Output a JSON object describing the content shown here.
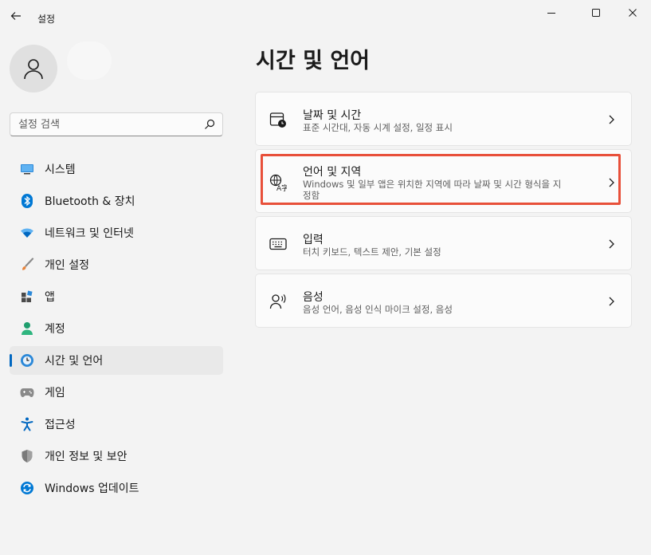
{
  "window": {
    "title": "설정"
  },
  "sidebar": {
    "search_placeholder": "설정 검색",
    "items": [
      {
        "label": "시스템",
        "icon": "monitor-icon",
        "active": false
      },
      {
        "label": "Bluetooth & 장치",
        "icon": "bluetooth-icon",
        "active": false
      },
      {
        "label": "네트워크 및 인터넷",
        "icon": "wifi-icon",
        "active": false
      },
      {
        "label": "개인 설정",
        "icon": "brush-icon",
        "active": false
      },
      {
        "label": "앱",
        "icon": "apps-icon",
        "active": false
      },
      {
        "label": "계정",
        "icon": "person-icon",
        "active": false
      },
      {
        "label": "시간 및 언어",
        "icon": "globe-clock-icon",
        "active": true
      },
      {
        "label": "게임",
        "icon": "gamepad-icon",
        "active": false
      },
      {
        "label": "접근성",
        "icon": "accessibility-icon",
        "active": false
      },
      {
        "label": "개인 정보 및 보안",
        "icon": "shield-icon",
        "active": false
      },
      {
        "label": "Windows 업데이트",
        "icon": "update-icon",
        "active": false
      }
    ]
  },
  "main": {
    "title": "시간 및 언어",
    "cards": [
      {
        "title": "날짜 및 시간",
        "desc": "표준 시간대, 자동 시계 설정, 일정 표시",
        "icon": "calendar-clock-icon"
      },
      {
        "title": "언어 및 지역",
        "desc_line1": "Windows 및 일부 앱은 위치한 지역에 따라 날짜 및 시간 형식을 지",
        "desc_line2": "정함",
        "icon": "language-icon"
      },
      {
        "title": "입력",
        "desc": "터치 키보드, 텍스트 제안, 기본 설정",
        "icon": "keyboard-icon"
      },
      {
        "title": "음성",
        "desc": "음성 언어, 음성 인식 마이크 설정, 음성",
        "icon": "speech-icon"
      }
    ]
  },
  "colors": {
    "accent": "#0067c0",
    "highlight": "#e8503a",
    "background": "#f3f3f3",
    "card": "#fbfbfb"
  }
}
